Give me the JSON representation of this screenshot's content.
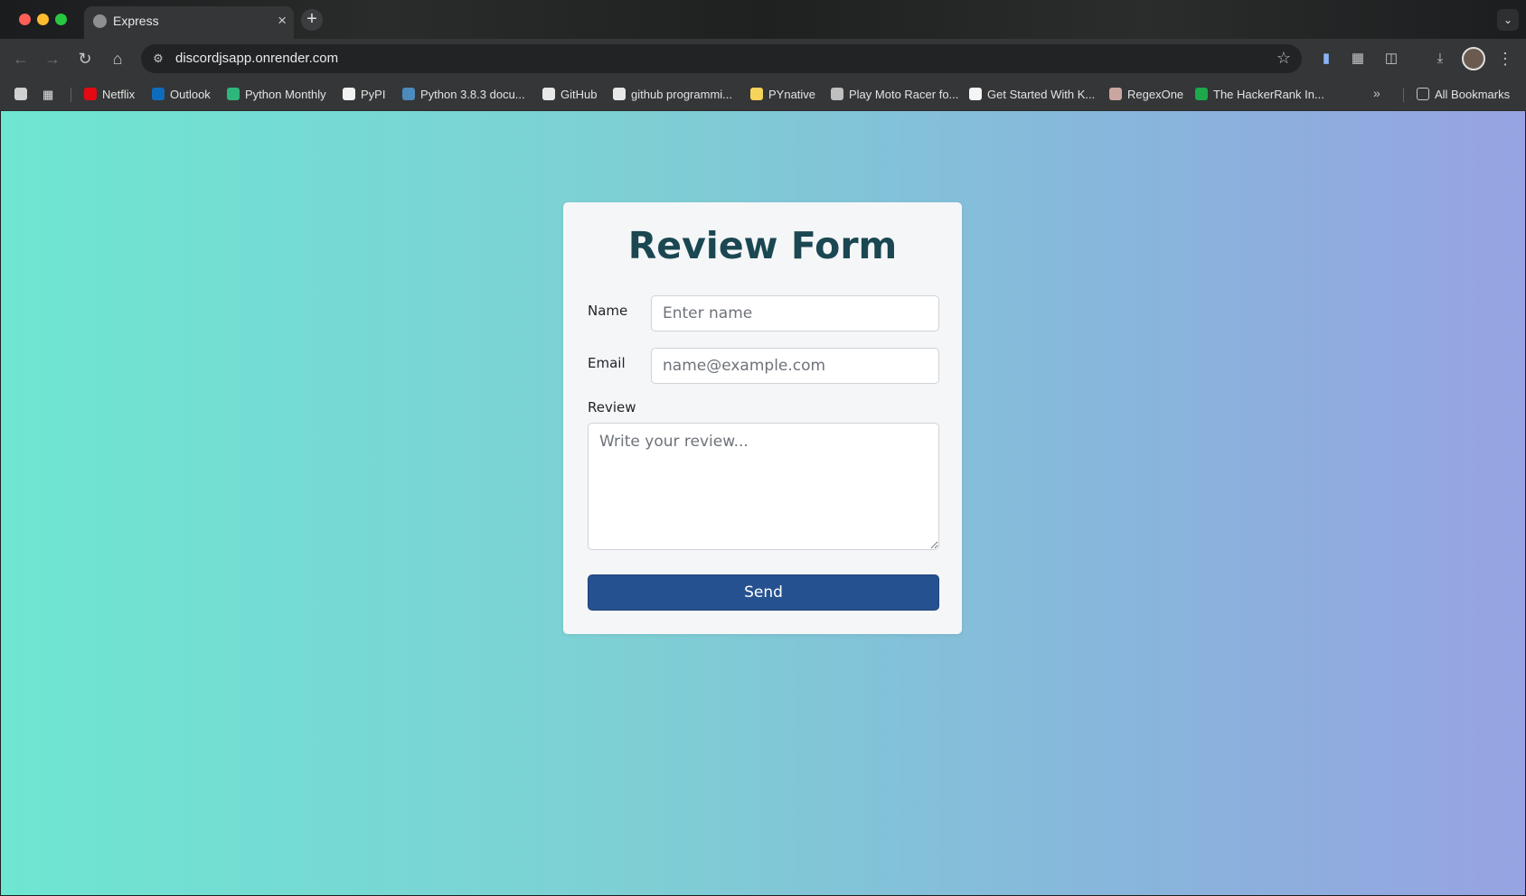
{
  "browser": {
    "tab": {
      "title": "Express",
      "close_icon": "×"
    },
    "new_tab_icon": "+",
    "url": "discordjsapp.onrender.com",
    "bookmarks": [
      {
        "label": "Netflix",
        "color": "#e50914"
      },
      {
        "label": "Outlook",
        "color": "#0f6cbd"
      },
      {
        "label": "Python Monthly",
        "color": "#2fb67c"
      },
      {
        "label": "PyPI",
        "color": "#f2f2f2"
      },
      {
        "label": "Python 3.8.3 docu...",
        "color": "#4b8bbe"
      },
      {
        "label": "GitHub",
        "color": "#e8e8e8"
      },
      {
        "label": "github programmi...",
        "color": "#e8e8e8"
      },
      {
        "label": "PYnative",
        "color": "#f6d35a"
      },
      {
        "label": "Play Moto Racer fo...",
        "color": "#bfbfbf"
      },
      {
        "label": "Get Started With K...",
        "color": "#f5f5f5"
      },
      {
        "label": "RegexOne",
        "color": "#c9a7a0"
      },
      {
        "label": "The HackerRank In...",
        "color": "#1ba94c"
      }
    ],
    "all_bookmarks_label": "All Bookmarks"
  },
  "form": {
    "title": "Review Form",
    "name_label": "Name",
    "name_placeholder": "Enter name",
    "email_label": "Email",
    "email_placeholder": "name@example.com",
    "review_label": "Review",
    "review_placeholder": "Write your review...",
    "send_label": "Send"
  },
  "colors": {
    "gradient_start": "#6ee6d2",
    "gradient_end": "#97a3e2",
    "title": "#1a4751",
    "button": "#265190"
  }
}
